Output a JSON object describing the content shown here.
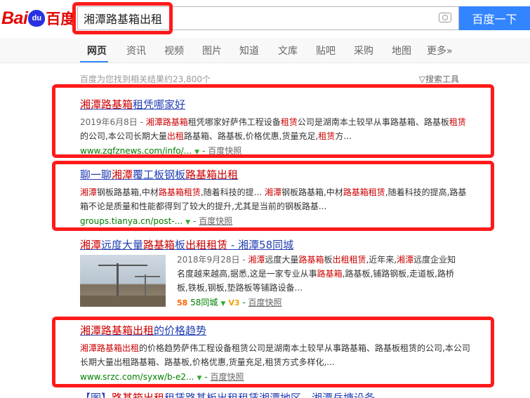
{
  "logo": {
    "text_bai": "Bai",
    "text_du": "du",
    "text_cn": "百度"
  },
  "search": {
    "query": "湘潭路基箱出租",
    "button": "百度一下"
  },
  "tabs": [
    {
      "label": "网页"
    },
    {
      "label": "资讯"
    },
    {
      "label": "视频"
    },
    {
      "label": "图片"
    },
    {
      "label": "知道"
    },
    {
      "label": "文库"
    },
    {
      "label": "贴吧"
    },
    {
      "label": "采购"
    },
    {
      "label": "地图"
    },
    {
      "label": "更多»"
    }
  ],
  "meta": {
    "count": "百度为您找到相关结果约23,800个",
    "tools": "搜索工具"
  },
  "results": [
    {
      "title_pre": "",
      "title_em": "湘潭路基箱",
      "title_post": "租凭哪家好",
      "date": "2019年6月8日 - ",
      "abs_1": "湘潭路基箱",
      "abs_2": "租凭哪家好萨伟工程设备",
      "abs_3": "租赁",
      "abs_4": "公司是湖南本土较早从事路基箱、路基板",
      "abs_5": "租赁",
      "abs_6": "的公司,本公司长期大量",
      "abs_7": "出租",
      "abs_8": "路基箱、路基板,价格优惠,货量充足,",
      "abs_9": "租赁",
      "abs_10": "方...",
      "url": "www.zgfznews.com/info/...",
      "snapshot": "百度快照"
    },
    {
      "title_pre": "聊一聊",
      "title_em": "湘潭",
      "title_mid": "覆工板钢板",
      "title_em2": "路基箱出租",
      "abs_1": "湘潭",
      "abs_2": "钢板路基箱,中材",
      "abs_3": "路基箱租赁",
      "abs_4": ",随着科技的提... ",
      "abs_5": "湘潭",
      "abs_6": "钢板路基箱,中材",
      "abs_7": "路基箱租赁",
      "abs_8": ",随着科技的提高,路基箱不论是质量和性能都得到了较大的提升,尤其是当前的钢板路基...",
      "url": "groups.tianya.cn/post-...",
      "snapshot": "百度快照"
    },
    {
      "title_em": "湘潭",
      "title_mid": "远度大量",
      "title_em2": "路基箱",
      "title_mid2": "板",
      "title_em3": "出租租赁",
      "title_post": " - 湘潭58同城",
      "date": "2018年9月28日 - ",
      "abs_1": "湘潭",
      "abs_2": "远度大量",
      "abs_3": "路基箱",
      "abs_4": "板",
      "abs_5": "出租租赁",
      "abs_6": ",近年来,",
      "abs_7": "湘潭",
      "abs_8": "远度企业知名度越来越高,据悉,这是一家专业从事",
      "abs_9": "路基箱",
      "abs_10": ",路基板,铺路钢板,走道板,路桥板,铁板,钢板,垫路板等铺路设备...",
      "site": "58同城",
      "badge": "58",
      "vip": "V3",
      "snapshot": "百度快照"
    },
    {
      "title_em": "湘潭路基箱出租",
      "title_post": "的价格趋势",
      "abs_1": "湘潭路基箱出租",
      "abs_2": "的价格趋势萨伟工程设备租赁公司是湖南本土较早从事路基箱、路基板租赁的公司,本公司长期大量出租路基箱、路基板,价格优惠,货量充足,租赁方式多样化,...",
      "url": "www.srzc.com/syxw/b-e2...",
      "snapshot": "百度快照"
    }
  ],
  "cutoff": {
    "pre": "【图】",
    "em": "路基箱出租",
    "post": "租赁路基板出租租赁湘潭地区 - 湘潭岳塘设备"
  },
  "colors": {
    "link": "#2440b3",
    "highlight": "#c00",
    "url": "#008000",
    "annotation": "#ff1a1a",
    "button": "#3385ff"
  }
}
